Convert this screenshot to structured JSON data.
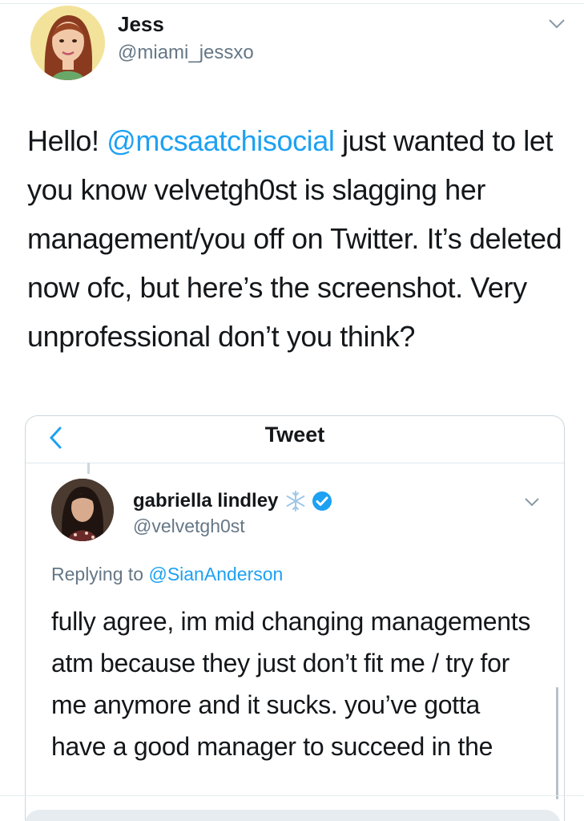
{
  "tweet": {
    "author_name": "Jess",
    "author_handle": "@miami_jessxo",
    "text_before_mention": "Hello! ",
    "mention": "@mcsaatchisocial",
    "text_after_mention": " just wanted to let you know  velvetgh0st is slagging her management/you off on Twitter. It’s deleted now ofc, but here’s the screenshot. Very unprofessional don’t you think?"
  },
  "embedded": {
    "header_title": "Tweet",
    "author_name": "gabriella lindley",
    "author_handle": "@velvetgh0st",
    "replying_prefix": "Replying to ",
    "replying_handle": "@SianAnderson",
    "text": "fully agree, im mid changing managements atm because they just don’t fit me / try for me anymore and it sucks. you’ve gotta have a good manager to succeed in the"
  },
  "colors": {
    "accent": "#1da1f2",
    "secondary_text": "#657786",
    "primary_text": "#14171a",
    "border": "#ccd6dd"
  },
  "icons": {
    "more": "chevron-down-icon",
    "back": "chevron-left-icon",
    "verified": "verified-badge-icon",
    "emoji": "snowflake-icon"
  }
}
